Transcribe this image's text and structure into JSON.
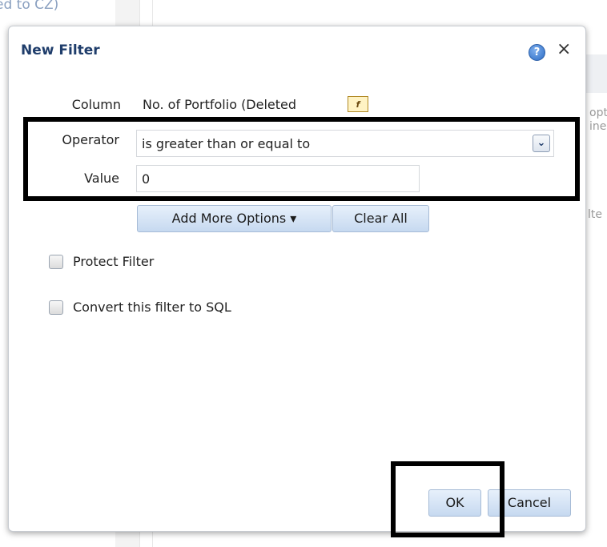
{
  "background": {
    "top_text": "ed to CZ)",
    "right_texts": [
      "opt",
      "ine",
      "lte"
    ]
  },
  "dialog": {
    "title": "New Filter",
    "help_icon": "?",
    "close_icon": "×",
    "fields": {
      "column_label": "Column",
      "column_value": "No. of Portfolio (Deleted",
      "fx_icon": "f",
      "operator_label": "Operator",
      "operator_value": "is greater than or equal to",
      "value_label": "Value",
      "value_value": "0"
    },
    "buttons": {
      "add_more_options": "Add More Options ▾",
      "clear_all": "Clear All",
      "ok": "OK",
      "cancel": "Cancel"
    },
    "checkboxes": {
      "protect_filter": "Protect Filter",
      "convert_to_sql": "Convert this filter to SQL"
    }
  },
  "colors": {
    "title": "#1f3d6b",
    "button_gradient_top": "#e7f0fb",
    "button_gradient_bottom": "#c6d9f0",
    "highlight": "#000000"
  }
}
